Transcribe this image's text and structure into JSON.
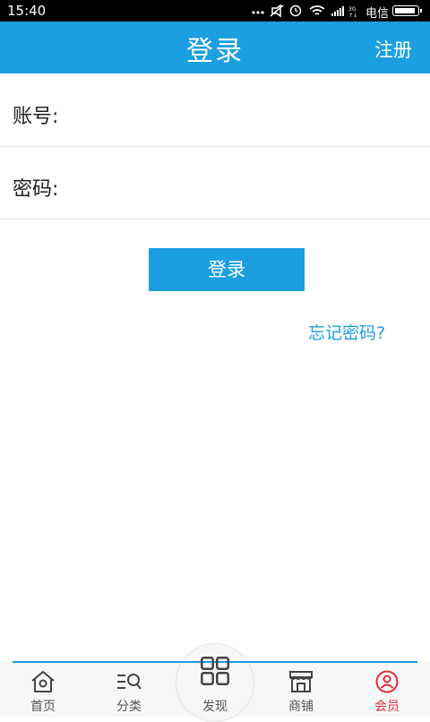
{
  "status_bar": {
    "time": "15:40",
    "carrier": "电信"
  },
  "header": {
    "title": "登录",
    "register_label": "注册"
  },
  "form": {
    "account_label": "账号:",
    "account_value": "",
    "password_label": "密码:",
    "password_value": "",
    "login_button": "登录",
    "forgot_link": "忘记密码?"
  },
  "bottom_nav": {
    "items": [
      {
        "label": "首页",
        "icon": "home-icon"
      },
      {
        "label": "分类",
        "icon": "category-icon"
      },
      {
        "label": "发现",
        "icon": "grid-icon"
      },
      {
        "label": "商铺",
        "icon": "shop-icon"
      },
      {
        "label": "会员",
        "icon": "member-icon",
        "active": true
      }
    ]
  },
  "colors": {
    "primary": "#1b9fe0",
    "active_tab": "#e0303b"
  }
}
